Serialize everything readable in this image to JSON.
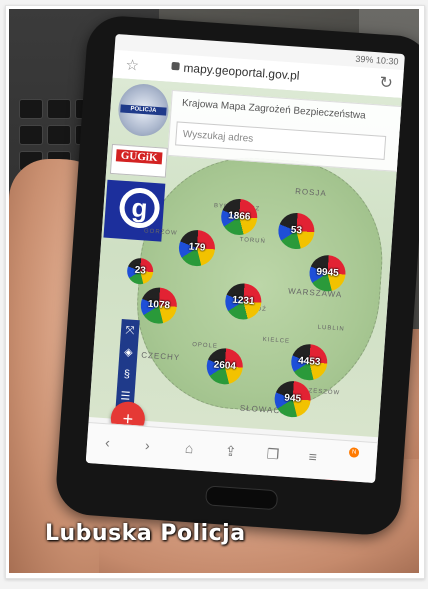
{
  "status": {
    "battery": "39%",
    "time": "10:30"
  },
  "browser": {
    "url": "mapy.geoportal.gov.pl"
  },
  "app": {
    "title": "Krajowa Mapa Zagrożeń Bezpieczeństwa",
    "search_placeholder": "Wyszukaj adres",
    "police_badge_text": "POLICJA",
    "gugik_logo_text": "GUGiK",
    "geoportal_logo_glyph": "g"
  },
  "map": {
    "labels": [
      "ROSJA",
      "WARSZAWA",
      "CZECHY",
      "SŁOWACJA",
      "GORZÓW",
      "BYDGOSZCZ",
      "TORUŃ",
      "ŁÓDŹ",
      "KIELCE",
      "LUBLIN",
      "OPOLE",
      "RZESZÓW"
    ],
    "clusters": [
      "1866",
      "53",
      "179",
      "9945",
      "23",
      "1078",
      "1231",
      "2604",
      "4453",
      "945"
    ],
    "cluster_colors": [
      "#e22233",
      "#f2c200",
      "#2a9a3a",
      "#1e4fd8",
      "#222222"
    ]
  },
  "navbar": {
    "badge": "N"
  },
  "watermark": "Lubuska Policja"
}
